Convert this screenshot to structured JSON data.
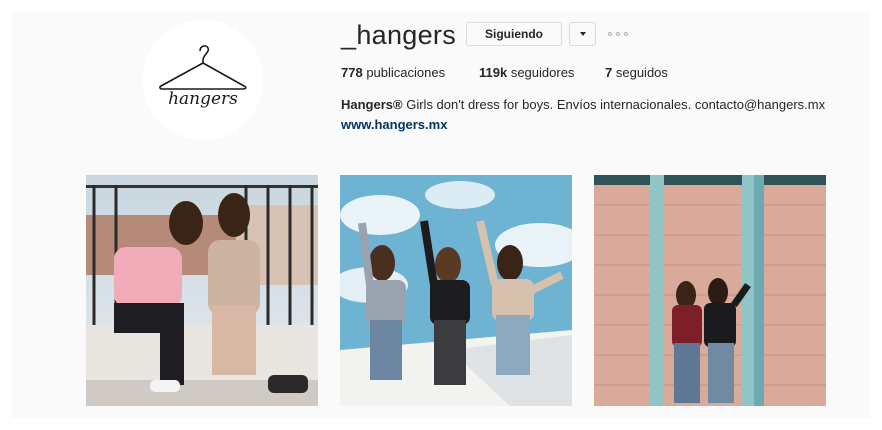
{
  "profile": {
    "username": "_hangers",
    "follow_label": "Siguiendo",
    "dropdown_icon": "chevron-down-icon",
    "more_icon": "more-options-icon",
    "logo_text": "hangers"
  },
  "stats": {
    "posts_count": "778",
    "posts_label": "publicaciones",
    "followers_count": "119k",
    "followers_label": "seguidores",
    "following_count": "7",
    "following_label": "seguidos"
  },
  "bio": {
    "name": "Hangers®",
    "text": " Girls don't dress for boys. Envíos internacionales. contacto@hangers.mx",
    "website": "www.hangers.mx"
  },
  "colors": {
    "background": "#fafafa",
    "text": "#262626",
    "link": "#003569",
    "border": "#dbdbdb"
  }
}
